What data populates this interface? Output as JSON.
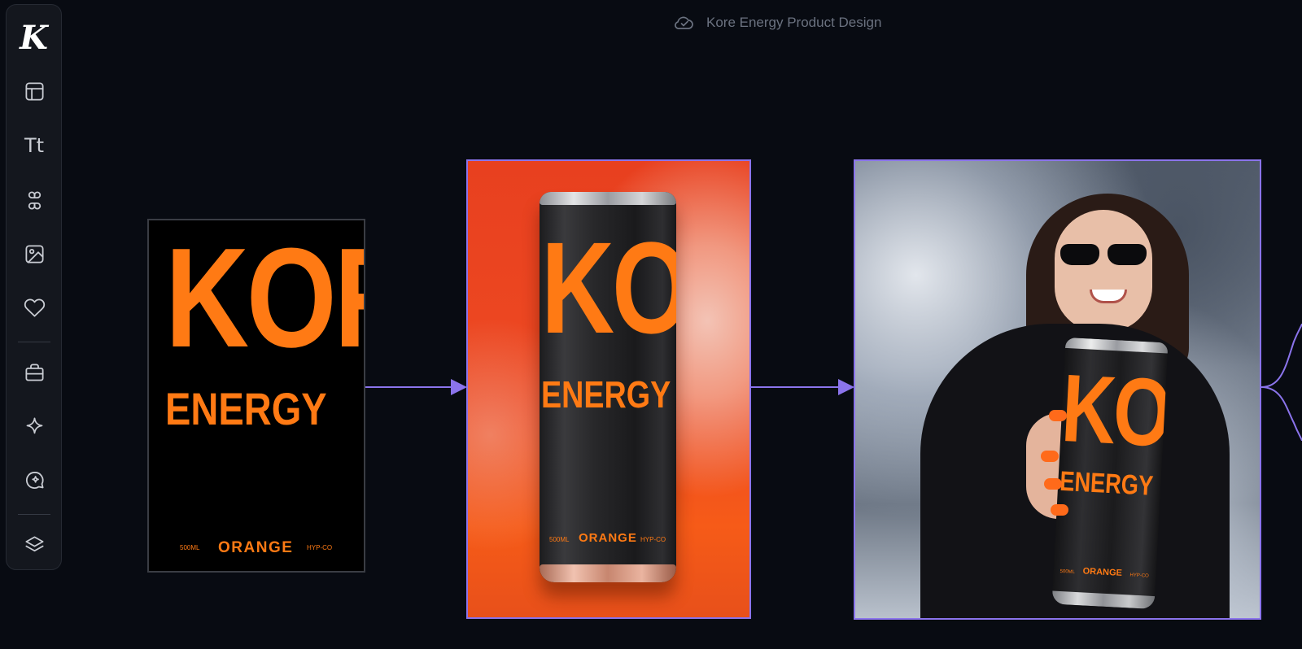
{
  "app": {
    "logo": "K",
    "document_title": "Kore Energy Product Design"
  },
  "sidebar": {
    "tools": [
      {
        "name": "layout-icon"
      },
      {
        "name": "text-icon",
        "glyph": "Tt"
      },
      {
        "name": "components-icon"
      },
      {
        "name": "image-icon"
      },
      {
        "name": "heart-icon"
      },
      {
        "name": "briefcase-icon"
      },
      {
        "name": "sparkle-icon"
      },
      {
        "name": "chat-sparkle-icon"
      },
      {
        "name": "layers-icon"
      }
    ]
  },
  "canvas": {
    "label_design": {
      "brand": "KORE",
      "product": "ENERGY",
      "volume": "500ML",
      "flavor": "ORANGE",
      "maker": "HYP-CO"
    },
    "product_shot": {
      "brand": "KORE",
      "product": "ENERGY",
      "volume": "500ML",
      "flavor": "ORANGE",
      "maker": "HYP-CO"
    },
    "lifestyle_shot": {
      "brand": "KORE",
      "product": "ENERGY",
      "volume": "500ML",
      "flavor": "ORANGE",
      "maker": "HYP-CO"
    }
  },
  "colors": {
    "background": "#080b12",
    "brand_orange": "#ff7a14",
    "connector": "#8b74ec",
    "sidebar": "#14171e"
  }
}
